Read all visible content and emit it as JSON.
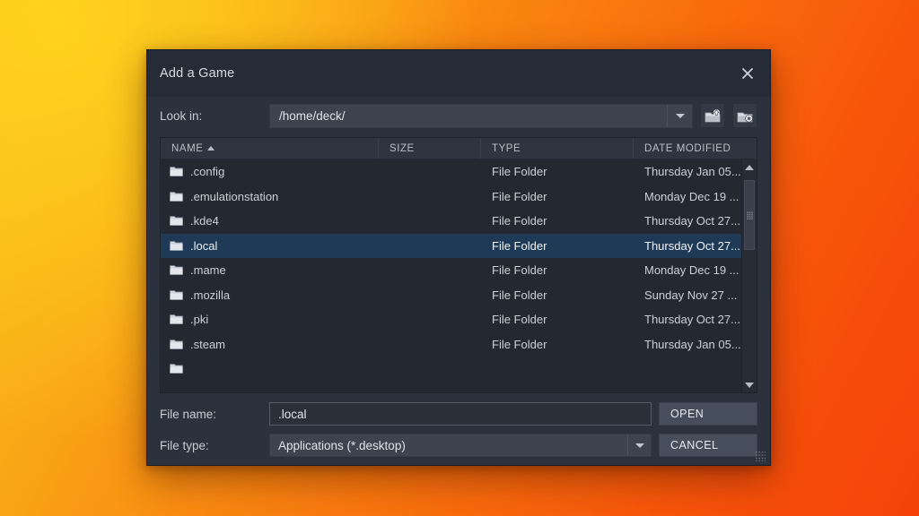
{
  "dialog": {
    "title": "Add a Game",
    "close_icon": "close-icon"
  },
  "lookin": {
    "label": "Look in:",
    "path": "/home/deck/",
    "dropdown_icon": "chevron-down-icon",
    "parent_dir_icon": "folder-up-icon",
    "new_folder_icon": "folder-new-icon"
  },
  "filelist": {
    "columns": [
      {
        "label": "NAME",
        "sort": "ascending"
      },
      {
        "label": "SIZE",
        "sort": ""
      },
      {
        "label": "TYPE",
        "sort": ""
      },
      {
        "label": "DATE MODIFIED",
        "sort": ""
      }
    ],
    "rows": [
      {
        "name": ".config",
        "size": "",
        "type": "File Folder",
        "date": "Thursday Jan 05...",
        "selected": false
      },
      {
        "name": ".emulationstation",
        "size": "",
        "type": "File Folder",
        "date": "Monday Dec 19 ...",
        "selected": false
      },
      {
        "name": ".kde4",
        "size": "",
        "type": "File Folder",
        "date": "Thursday Oct 27...",
        "selected": false
      },
      {
        "name": ".local",
        "size": "",
        "type": "File Folder",
        "date": "Thursday Oct 27...",
        "selected": true
      },
      {
        "name": ".mame",
        "size": "",
        "type": "File Folder",
        "date": "Monday Dec 19 ...",
        "selected": false
      },
      {
        "name": ".mozilla",
        "size": "",
        "type": "File Folder",
        "date": "Sunday Nov 27 ...",
        "selected": false
      },
      {
        "name": ".pki",
        "size": "",
        "type": "File Folder",
        "date": "Thursday Oct 27...",
        "selected": false
      },
      {
        "name": ".steam",
        "size": "",
        "type": "File Folder",
        "date": "Thursday Jan 05...",
        "selected": false
      },
      {
        "name": "",
        "size": "",
        "type": "",
        "date": "",
        "selected": false
      }
    ],
    "scrollbar": {
      "up_icon": "scroll-up-arrow-icon",
      "down_icon": "scroll-down-arrow-icon",
      "thumb_grip_icon": "grip-dots-icon"
    }
  },
  "form": {
    "filename_label": "File name:",
    "filename_value": ".local",
    "filetype_label": "File type:",
    "filetype_value": "Applications (*.desktop)",
    "filetype_dropdown_icon": "chevron-down-icon",
    "open_label": "OPEN",
    "cancel_label": "CANCEL",
    "resize_grip_icon": "resize-grip-icon"
  },
  "colors": {
    "dialog_bg": "#2b313d",
    "titlebar_bg": "#252b37",
    "list_bg": "#232831",
    "selection_blue": "#1e3a56",
    "combo_bg": "#3d4450",
    "button_bg": "#474e5b",
    "text": "#d2d6dd",
    "backdrop_yellow": "#F7C01C",
    "backdrop_orange": "#F54309"
  }
}
